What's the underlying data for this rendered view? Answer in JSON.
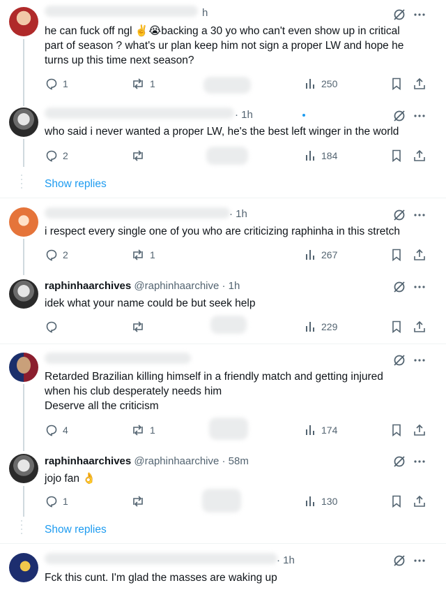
{
  "tweets": [
    {
      "id": "t1",
      "author_name": "",
      "handle": "",
      "time": "h",
      "lines": [
        "he can fuck off ngl ✌️😭backing a 30 yo who can't even show up in critical",
        "part of season ? what's ur plan keep him not sign a proper LW and hope he",
        "turns up this time next season?"
      ],
      "replies": "1",
      "reposts": "1",
      "views": "250"
    },
    {
      "id": "t2",
      "author_name": "",
      "handle": "",
      "time": "· 1h",
      "lines": [
        "who said i never wanted a proper LW, he's the best left winger in the world"
      ],
      "replies": "2",
      "reposts": "",
      "views": "184",
      "show_replies": "Show replies"
    },
    {
      "id": "t3",
      "author_name": "",
      "handle": "",
      "time": "· 1h",
      "lines": [
        "i respect every single one of you who are criticizing raphinha in this stretch"
      ],
      "replies": "2",
      "reposts": "1",
      "views": "267"
    },
    {
      "id": "t4",
      "author_name": "raphinhaarchives",
      "handle": "@raphinhaarchive · 1h",
      "time": "",
      "lines": [
        "idek what your name could be but seek help"
      ],
      "replies": "",
      "reposts": "",
      "views": "229"
    },
    {
      "id": "t5",
      "author_name": "",
      "handle": "",
      "time": "",
      "lines": [
        "Retarded Brazilian killing himself in a friendly match and getting injured",
        "when his club desperately needs him",
        "Deserve all the criticism"
      ],
      "replies": "4",
      "reposts": "1",
      "views": "174"
    },
    {
      "id": "t6",
      "author_name": "raphinhaarchives",
      "handle": "@raphinhaarchive · 58m",
      "time": "",
      "lines": [
        "jojo fan 👌"
      ],
      "replies": "1",
      "reposts": "",
      "views": "130",
      "show_replies": "Show replies"
    },
    {
      "id": "t7",
      "author_name": "",
      "handle": "",
      "time": "· 1h",
      "lines": [
        "Fck this cunt. I'm glad the masses are waking up"
      ]
    }
  ],
  "icons": {
    "reply": "reply-icon",
    "repost": "repost-icon",
    "like": "like-icon",
    "views": "views-icon",
    "bookmark": "bookmark-icon",
    "share": "share-icon",
    "grok": "grok-icon",
    "more": "more-icon"
  },
  "colors": {
    "link": "#1d9bf0",
    "muted": "#536471",
    "text": "#0f1419",
    "line": "#cfd9de"
  }
}
